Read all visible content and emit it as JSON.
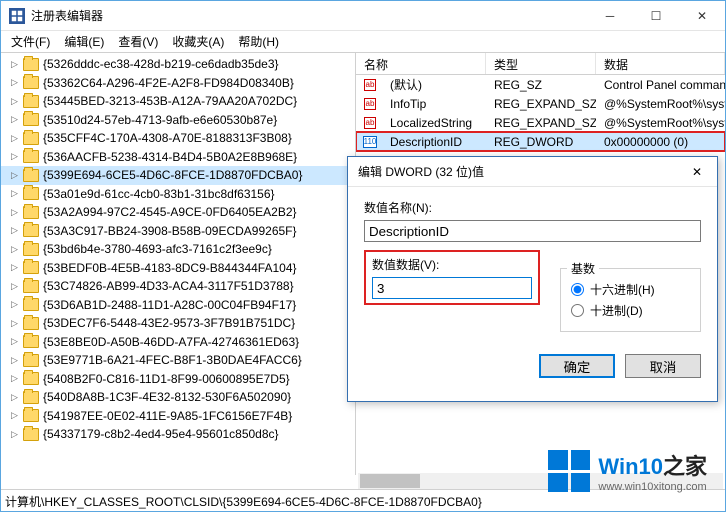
{
  "window": {
    "title": "注册表编辑器"
  },
  "menu": [
    "文件(F)",
    "编辑(E)",
    "查看(V)",
    "收藏夹(A)",
    "帮助(H)"
  ],
  "tree": [
    "{5326dddc-ec38-428d-b219-ce6dadb35de3}",
    "{53362C64-A296-4F2E-A2F8-FD984D08340B}",
    "{53445BED-3213-453B-A12A-79AA20A702DC}",
    "{53510d24-57eb-4713-9afb-e6e60530b87e}",
    "{535CFF4C-170A-4308-A70E-8188313F3B08}",
    "{536AACFB-5238-4314-B4D4-5B0A2E8B968E}",
    "{5399E694-6CE5-4D6C-8FCE-1D8870FDCBA0}",
    "{53a01e9d-61cc-4cb0-83b1-31bc8df63156}",
    "{53A2A994-97C2-4545-A9CE-0FD6405EA2B2}",
    "{53A3C917-BB24-3908-B58B-09ECDA99265F}",
    "{53bd6b4e-3780-4693-afc3-7161c2f3ee9c}",
    "{53BEDF0B-4E5B-4183-8DC9-B844344FA104}",
    "{53C74826-AB99-4D33-ACA4-3117F51D3788}",
    "{53D6AB1D-2488-11D1-A28C-00C04FB94F17}",
    "{53DEC7F6-5448-43E2-9573-3F7B91B751DC}",
    "{53E8BE0D-A50B-46DD-A7FA-42746361ED63}",
    "{53E9771B-6A21-4FEC-B8F1-3B0DAE4FACC6}",
    "{5408B2F0-C816-11D1-8F99-00600895E7D5}",
    "{540D8A8B-1C3F-4E32-8132-530F6A502090}",
    "{541987EE-0E02-411E-9A85-1FC6156E7F4B}",
    "{54337179-c8b2-4ed4-95e4-95601c850d8c}"
  ],
  "tree_selected_index": 6,
  "list": {
    "headers": {
      "name": "名称",
      "type": "类型",
      "data": "数据"
    },
    "rows": [
      {
        "name": "(默认)",
        "type": "REG_SZ",
        "data": "Control Panel command",
        "icon": "str"
      },
      {
        "name": "InfoTip",
        "type": "REG_EXPAND_SZ",
        "data": "@%SystemRoot%\\syster",
        "icon": "str"
      },
      {
        "name": "LocalizedString",
        "type": "REG_EXPAND_SZ",
        "data": "@%SystemRoot%\\syster",
        "icon": "str"
      },
      {
        "name": "DescriptionID",
        "type": "REG_DWORD",
        "data": "0x00000000 (0)",
        "icon": "bin"
      }
    ],
    "selected_row_index": 3
  },
  "dialog": {
    "title": "编辑 DWORD (32 位)值",
    "name_label": "数值名称(N):",
    "name_value": "DescriptionID",
    "data_label": "数值数据(V):",
    "data_value": "3",
    "base_legend": "基数",
    "radio_hex": "十六进制(H)",
    "radio_dec": "十进制(D)",
    "ok": "确定",
    "cancel": "取消"
  },
  "statusbar": "计算机\\HKEY_CLASSES_ROOT\\CLSID\\{5399E694-6CE5-4D6C-8FCE-1D8870FDCBA0}",
  "watermark": {
    "brand_a": "Win10",
    "brand_b": "之家",
    "url": "www.win10xitong.com"
  }
}
